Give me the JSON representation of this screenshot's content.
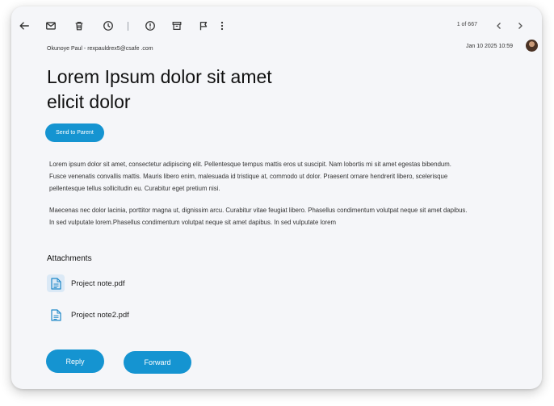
{
  "toolbar": {
    "icons": [
      "back-arrow-icon",
      "mail-icon",
      "trash-icon",
      "clock-icon",
      "alert-icon",
      "archive-icon",
      "flag-icon",
      "more-vert-icon"
    ],
    "pager_text": "1 of 667"
  },
  "email": {
    "sender": "Okunoye Paul - rexpauldrex5@csafe .com",
    "datetime": "Jan 10 2025  10:59",
    "subject": "Lorem Ipsum dolor sit amet elicit dolor",
    "send_to_parent_label": "Send to Parent",
    "paragraphs": [
      "Lorem ipsum dolor sit amet, consectetur adipiscing elit. Pellentesque tempus mattis eros ut suscipit. Nam lobortis mi sit amet egestas bibendum. Fusce venenatis convallis mattis. Mauris libero enim, malesuada id tristique at, commodo ut dolor. Praesent ornare hendrerit libero, scelerisque pellentesque tellus sollicitudin eu. Curabitur eget pretium nisi.",
      "Maecenas nec dolor lacinia, porttitor magna ut, dignissim arcu. Curabitur vitae feugiat libero. Phasellus condimentum volutpat neque sit amet dapibus. In sed vulputate lorem.Phasellus condimentum volutpat neque sit amet dapibus. In sed vulputate lorem"
    ]
  },
  "attachments": {
    "title": "Attachments",
    "files": [
      {
        "name": "Project note.pdf"
      },
      {
        "name": "Project note2.pdf"
      }
    ]
  },
  "actions": {
    "reply_label": "Reply",
    "forward_label": "Forward"
  },
  "colors": {
    "accent": "#1594d1",
    "background": "#f5f6f9",
    "file_icon": "#1e88c8"
  }
}
